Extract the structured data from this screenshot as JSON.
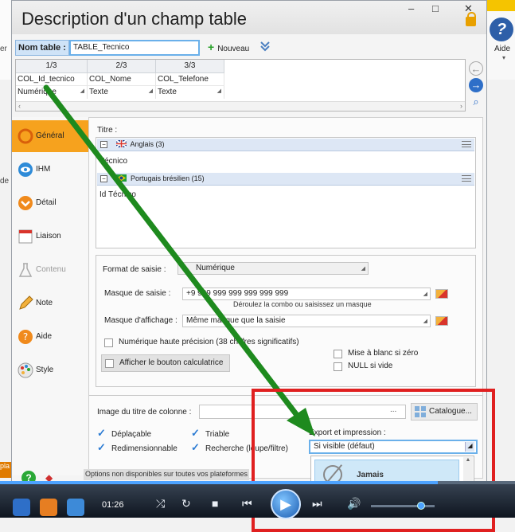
{
  "window": {
    "title": "Description d'un champ table",
    "min_glyph": "–",
    "max_glyph": "□",
    "close_glyph": "✕"
  },
  "background": {
    "aide_label": "Aide",
    "aide_caret": "▾",
    "left_text_1": "er",
    "left_text_2": "de",
    "left_orange_text": "pla"
  },
  "toolbar": {
    "table_label": "Nom table :",
    "table_value": "TABLE_Tecnico",
    "new_label": "Nouveau"
  },
  "columns": [
    {
      "index": "1/3",
      "name": "COL_Id_tecnico",
      "type": "Numérique"
    },
    {
      "index": "2/3",
      "name": "COL_Nome",
      "type": "Texte"
    },
    {
      "index": "3/3",
      "name": "COL_Telefone",
      "type": "Texte"
    }
  ],
  "tabs": [
    {
      "label": "Général",
      "icon": "general-icon",
      "active": true
    },
    {
      "label": "IHM",
      "icon": "eye-icon"
    },
    {
      "label": "Détail",
      "icon": "detail-icon"
    },
    {
      "label": "Liaison",
      "icon": "link-icon"
    },
    {
      "label": "Contenu",
      "icon": "flask-icon",
      "disabled": true
    },
    {
      "label": "Note",
      "icon": "pencil-icon"
    },
    {
      "label": "Aide",
      "icon": "help-icon"
    },
    {
      "label": "Style",
      "icon": "palette-icon"
    }
  ],
  "titre": {
    "label": "Titre :",
    "languages": [
      {
        "name": "Anglais (3)",
        "text": "Técnico"
      },
      {
        "name": "Portugais brésilien (15)",
        "text": "Id Técnico"
      }
    ]
  },
  "format": {
    "label": "Format de saisie :",
    "value": "Numérique",
    "mask_label": "Masque de saisie :",
    "mask_value": "+9 999 999 999 999 999 999",
    "mask_hint": "Déroulez la combo ou saisissez un masque",
    "display_mask_label": "Masque d'affichage :",
    "display_mask_value": "Même masque que la saisie",
    "high_precision": "Numérique haute précision (38 chiffres significatifs)",
    "calc_button": "Afficher le bouton calculatrice",
    "blank_if_zero": "Mise à blanc si zéro",
    "null_if_empty": "NULL si vide"
  },
  "bottom": {
    "image_label": "Image du titre de colonne :",
    "dots": "...",
    "catalogue": "Catalogue...",
    "checks": [
      {
        "label": "Déplaçable"
      },
      {
        "label": "Triable"
      },
      {
        "label": "Redimensionnable"
      },
      {
        "label": "Recherche (loupe/filtre)"
      }
    ],
    "export_label": "Export et impression :",
    "export_value": "Si visible (défaut)",
    "dropdown_item": "Jamais",
    "footer_note": "Options non disponibles sur toutes vos plateformes"
  },
  "player": {
    "time": "01:26"
  }
}
